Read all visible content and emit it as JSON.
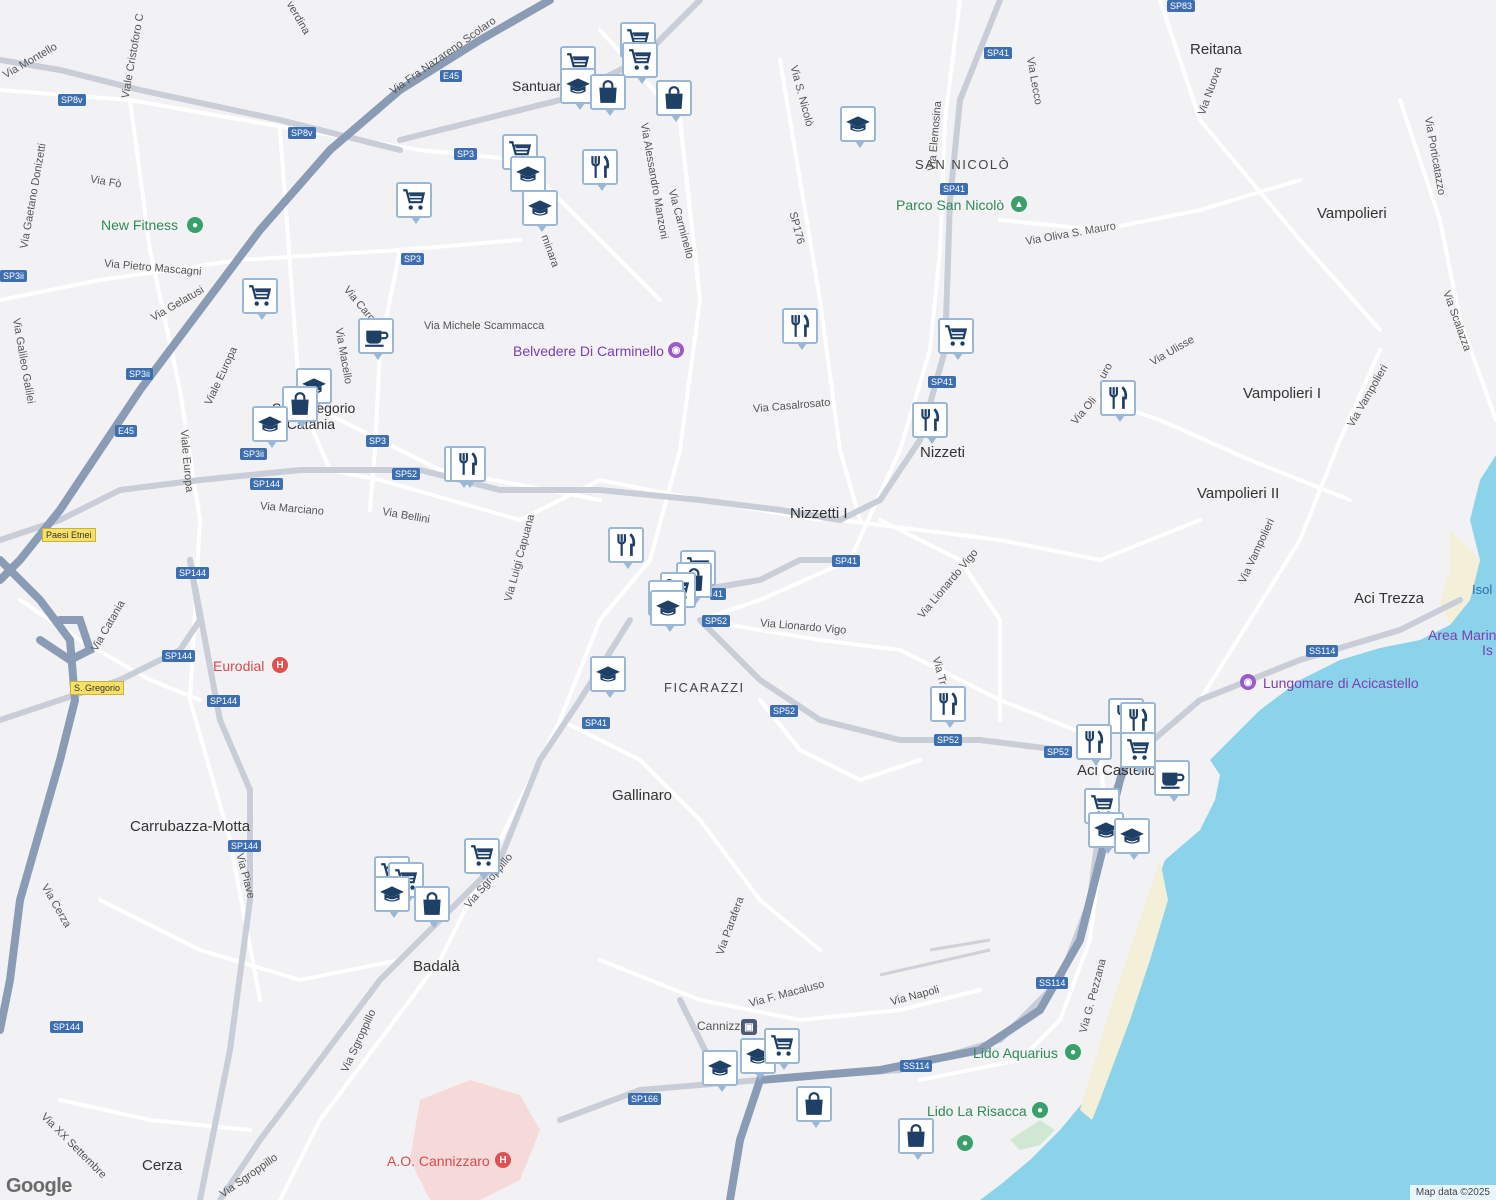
{
  "colors": {
    "land": "#f2f1f4",
    "water": "#8bd3ea",
    "road_minor": "#ffffff",
    "highway": "#8a9bb5",
    "beach": "#f3efd8",
    "hospital_area": "#f6d9d9",
    "park": "#cfe8d4",
    "pin_border": "#9ab7d6",
    "pin_icon": "#1e3f66"
  },
  "places": [
    {
      "name": "Reitana"
    },
    {
      "name": "Vampolieri"
    },
    {
      "name": "Vampolieri I"
    },
    {
      "name": "Vampolieri II"
    },
    {
      "name": "Nizzeti"
    },
    {
      "name": "Nizzetti I"
    },
    {
      "name": "SAN NICOLÒ"
    },
    {
      "name": "FICARAZZI"
    },
    {
      "name": "Gallinaro"
    },
    {
      "name": "Carrubazza-Motta"
    },
    {
      "name": "Badalà"
    },
    {
      "name": "Cerza"
    },
    {
      "name": "Aci Trezza"
    },
    {
      "name": "Aci Castello"
    },
    {
      "name": "Cannizzaro"
    },
    {
      "name": "Santuario"
    },
    {
      "name": "San Gregorio"
    },
    {
      "name": "di Catania"
    },
    {
      "name": "Isol"
    }
  ],
  "streets": [
    {
      "name": "Via Montello"
    },
    {
      "name": "Viale Cristoforo C"
    },
    {
      "name": "Via Fra Nazareno Scolaro"
    },
    {
      "name": "verdina"
    },
    {
      "name": "Via Fò"
    },
    {
      "name": "Via Gaetano Donizetti"
    },
    {
      "name": "Via Pietro Mascagni"
    },
    {
      "name": "Via Gelatusi"
    },
    {
      "name": "Via Galileo Galilei"
    },
    {
      "name": "Viale Europa"
    },
    {
      "name": "Viale Europa"
    },
    {
      "name": "Via Carc"
    },
    {
      "name": "Via Macello"
    },
    {
      "name": "Via Michele Scammacca"
    },
    {
      "name": "Via Alessandro Manzoni"
    },
    {
      "name": "Via Carminello"
    },
    {
      "name": "minara"
    },
    {
      "name": "Via S. Nicolò"
    },
    {
      "name": "SP176"
    },
    {
      "name": "Via Elemosina"
    },
    {
      "name": "Via Lecco"
    },
    {
      "name": "Via Nuova"
    },
    {
      "name": "Via Porticatazzo"
    },
    {
      "name": "Via Oliva S. Mauro"
    },
    {
      "name": "Via Scalazza"
    },
    {
      "name": "Via Ulisse"
    },
    {
      "name": "Via Oli"
    },
    {
      "name": "uro"
    },
    {
      "name": "Via Vampolieri"
    },
    {
      "name": "Via Vampolieri"
    },
    {
      "name": "Via Casalrosato"
    },
    {
      "name": "Via Marciano"
    },
    {
      "name": "Via Bellini"
    },
    {
      "name": "Via Luigi Capuana"
    },
    {
      "name": "Via Lionardo Vigo"
    },
    {
      "name": "Via Lionardo Vigo"
    },
    {
      "name": "Via Tr"
    },
    {
      "name": "Via Catania"
    },
    {
      "name": "Via Piave"
    },
    {
      "name": "Via Cerza"
    },
    {
      "name": "Via Sgroppillo"
    },
    {
      "name": "Via Sgroppillo"
    },
    {
      "name": "Via Sgroppillo"
    },
    {
      "name": "Via Parafera"
    },
    {
      "name": "Via F. Macaluso"
    },
    {
      "name": "Via Napoli"
    },
    {
      "name": "Via G. Pezzana"
    },
    {
      "name": "Via XX Settembre"
    }
  ],
  "shields": [
    {
      "text": "E45"
    },
    {
      "text": "SP8v"
    },
    {
      "text": "SP8v"
    },
    {
      "text": "SP3"
    },
    {
      "text": "SP3"
    },
    {
      "text": "SP3ii"
    },
    {
      "text": "SP3ii"
    },
    {
      "text": "SP3ii"
    },
    {
      "text": "E45"
    },
    {
      "text": "SP3"
    },
    {
      "text": "SP144"
    },
    {
      "text": "SP52"
    },
    {
      "text": "SP144"
    },
    {
      "text": "SP144"
    },
    {
      "text": "SP144"
    },
    {
      "text": "SP144"
    },
    {
      "text": "SP144"
    },
    {
      "text": "SP41"
    },
    {
      "text": "SP41"
    },
    {
      "text": "SP41"
    },
    {
      "text": "SP41"
    },
    {
      "text": "SP83"
    },
    {
      "text": "41"
    },
    {
      "text": "SP52"
    },
    {
      "text": "SP52"
    },
    {
      "text": "SP52"
    },
    {
      "text": "SP52"
    },
    {
      "text": "SP41"
    },
    {
      "text": "SS114"
    },
    {
      "text": "SS114"
    },
    {
      "text": "SS114"
    },
    {
      "text": "SP166"
    }
  ],
  "yellow_shields": [
    {
      "text": "Paesi Etnei"
    },
    {
      "text": "S. Gregorio"
    }
  ],
  "pois": [
    {
      "name": "New Fitness",
      "kind": "green"
    },
    {
      "name": "Parco San Nicolò",
      "kind": "green"
    },
    {
      "name": "Belvedere Di Carminello",
      "kind": "purple"
    },
    {
      "name": "Lungomare di Acicastello",
      "kind": "purple"
    },
    {
      "name": "Eurodial",
      "kind": "red"
    },
    {
      "name": "A.O. Cannizzaro",
      "kind": "red"
    },
    {
      "name": "Lido Aquarius",
      "kind": "green"
    },
    {
      "name": "Lido La Risacca",
      "kind": "green"
    },
    {
      "name": "Area Marin",
      "kind": "purple"
    },
    {
      "name": "Is",
      "kind": "purple"
    }
  ],
  "markers": [
    {
      "icon": "cart-icon"
    },
    {
      "icon": "cart-icon"
    },
    {
      "icon": "cart-icon"
    },
    {
      "icon": "school-icon"
    },
    {
      "icon": "bag-icon"
    },
    {
      "icon": "bag-icon"
    },
    {
      "icon": "cart-icon"
    },
    {
      "icon": "school-icon"
    },
    {
      "icon": "restaurant-icon"
    },
    {
      "icon": "school-icon"
    },
    {
      "icon": "cart-icon"
    },
    {
      "icon": "school-icon"
    },
    {
      "icon": "cart-icon"
    },
    {
      "icon": "cafe-icon"
    },
    {
      "icon": "school-icon"
    },
    {
      "icon": "bag-icon"
    },
    {
      "icon": "school-icon"
    },
    {
      "icon": "restaurant-icon"
    },
    {
      "icon": "restaurant-icon"
    },
    {
      "icon": "cart-icon"
    },
    {
      "icon": "restaurant-icon"
    },
    {
      "icon": "restaurant-icon"
    },
    {
      "icon": "restaurant-icon"
    },
    {
      "icon": "restaurant-icon"
    },
    {
      "icon": "cart-icon"
    },
    {
      "icon": "bag-icon"
    },
    {
      "icon": "cart-icon"
    },
    {
      "icon": "school-icon"
    },
    {
      "icon": "school-icon"
    },
    {
      "icon": "school-icon"
    },
    {
      "icon": "restaurant-icon"
    },
    {
      "icon": "restaurant-icon"
    },
    {
      "icon": "restaurant-icon"
    },
    {
      "icon": "restaurant-icon"
    },
    {
      "icon": "cart-icon"
    },
    {
      "icon": "cafe-icon"
    },
    {
      "icon": "cart-icon"
    },
    {
      "icon": "school-icon"
    },
    {
      "icon": "school-icon"
    },
    {
      "icon": "cart-icon"
    },
    {
      "icon": "cart-icon"
    },
    {
      "icon": "school-icon"
    },
    {
      "icon": "bag-icon"
    },
    {
      "icon": "cart-icon"
    },
    {
      "icon": "school-icon"
    },
    {
      "icon": "school-icon"
    },
    {
      "icon": "cart-icon"
    },
    {
      "icon": "bag-icon"
    },
    {
      "icon": "bag-icon"
    }
  ],
  "footer": {
    "attribution": "Map data ©2025",
    "logo": "Google"
  }
}
